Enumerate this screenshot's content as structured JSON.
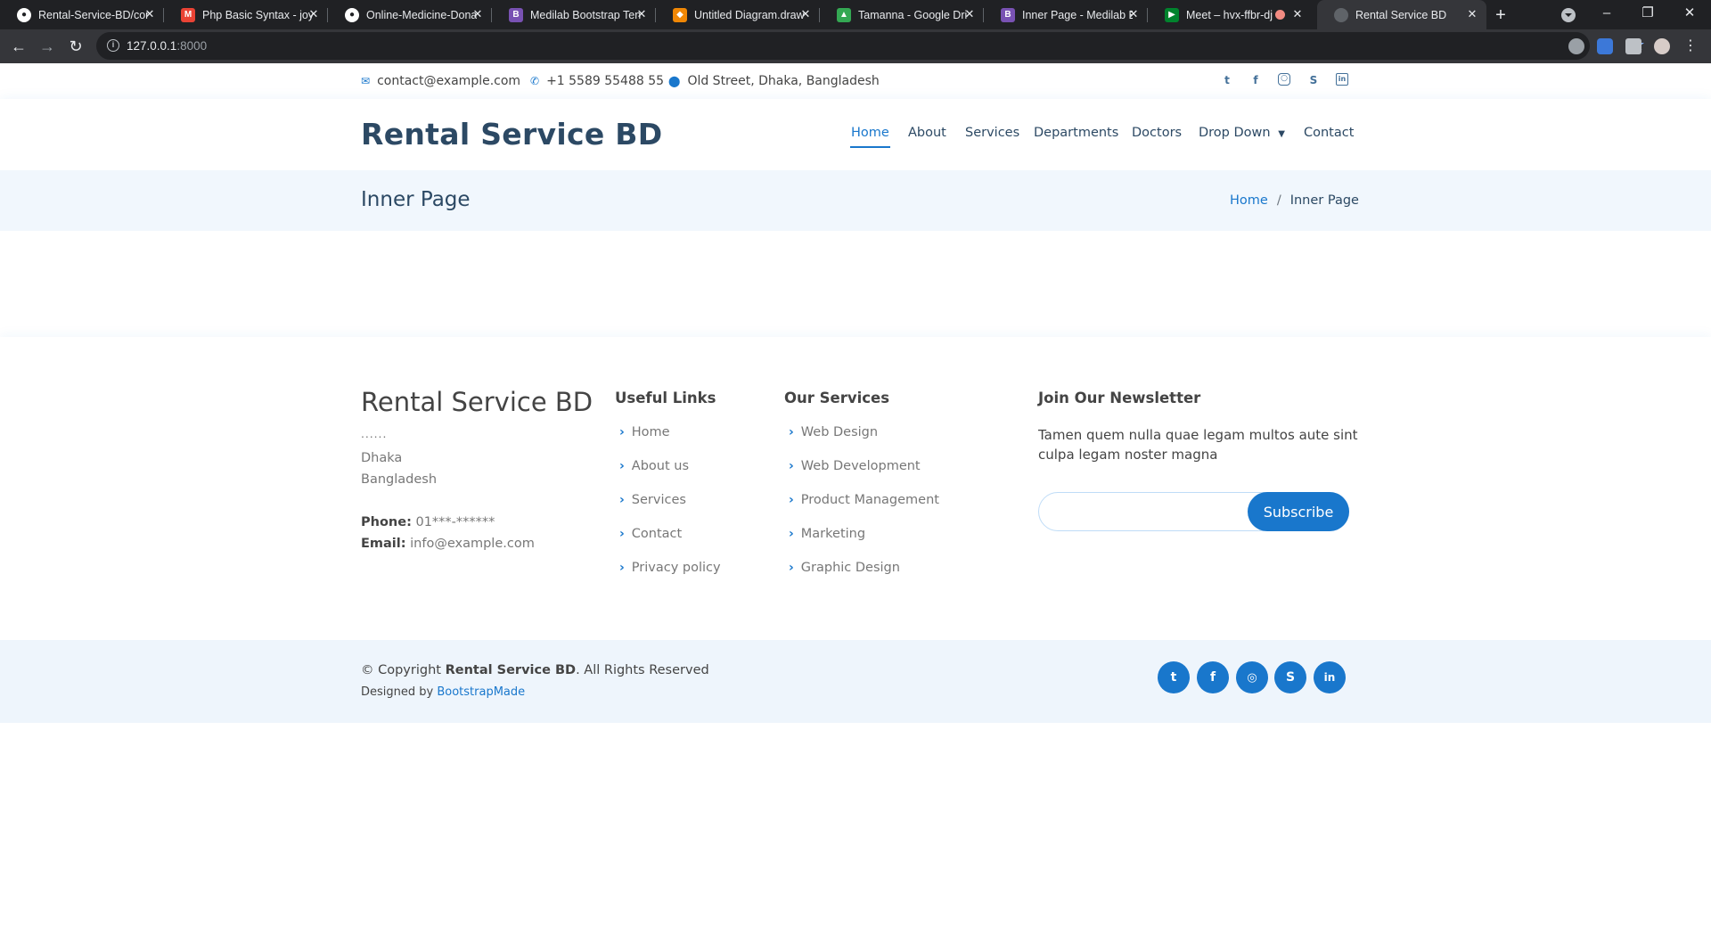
{
  "browser": {
    "tabs": [
      {
        "title": "Rental-Service-BD/com",
        "icon": "github-icon"
      },
      {
        "title": "Php Basic Syntax - joy",
        "icon": "gmail-icon"
      },
      {
        "title": "Online-Medicine-Dona",
        "icon": "github-icon"
      },
      {
        "title": "Medilab Bootstrap Ten",
        "icon": "bootstrap-icon"
      },
      {
        "title": "Untitled Diagram.draw",
        "icon": "drawio-icon"
      },
      {
        "title": "Tamanna - Google Dri",
        "icon": "google-drive-icon"
      },
      {
        "title": "Inner Page - Medilab B",
        "icon": "bootstrap-icon"
      },
      {
        "title": "Meet – hvx-ffbr-dj",
        "icon": "google-meet-icon"
      },
      {
        "title": "Rental Service BD",
        "icon": "globe-icon",
        "active": true
      }
    ],
    "url_host": "127.0.0.1",
    "url_port": ":8000"
  },
  "topbar": {
    "email": "contact@example.com",
    "phone": "+1 5589 55488 55",
    "address": "Old Street, Dhaka, Bangladesh",
    "social_icons": [
      "twitter-icon",
      "facebook-icon",
      "instagram-icon",
      "skype-icon",
      "linkedin-icon"
    ]
  },
  "header": {
    "logo": "Rental Service BD",
    "nav": [
      "Home",
      "About",
      "Services",
      "Departments",
      "Doctors",
      "Drop Down",
      "Contact"
    ],
    "active_nav": "Home"
  },
  "breadcrumbs": {
    "title": "Inner Page",
    "home": "Home",
    "separator": "/",
    "current": "Inner Page"
  },
  "footer": {
    "brand": "Rental Service BD",
    "dots": "......",
    "address_line1": "Dhaka",
    "address_line2": "Bangladesh",
    "phone_label": "Phone:",
    "phone_value": "01***-******",
    "email_label": "Email:",
    "email_value": "info@example.com",
    "useful_links_title": "Useful Links",
    "useful_links": [
      "Home",
      "About us",
      "Services",
      "Contact",
      "Privacy policy"
    ],
    "services_title": "Our Services",
    "services": [
      "Web Design",
      "Web Development",
      "Product Management",
      "Marketing",
      "Graphic Design"
    ],
    "newsletter_title": "Join Our Newsletter",
    "newsletter_text": "Tamen quem nulla quae legam multos aute sint culpa legam noster magna",
    "subscribe_label": "Subscribe",
    "copyright_prefix": "© Copyright",
    "copyright_brand": "Rental Service BD",
    "copyright_suffix": ". All Rights Reserved",
    "designed_by": "Designed by",
    "designer": "BootstrapMade",
    "social_buttons": [
      "twitter-icon",
      "facebook-icon",
      "instagram-icon",
      "skype-icon",
      "linkedin-icon"
    ]
  },
  "colors": {
    "accent": "#1977cc",
    "heading": "#2c4964",
    "breadcrumb_bg": "#f1f7fd",
    "footer_bottom_bg": "#eef5fc"
  }
}
